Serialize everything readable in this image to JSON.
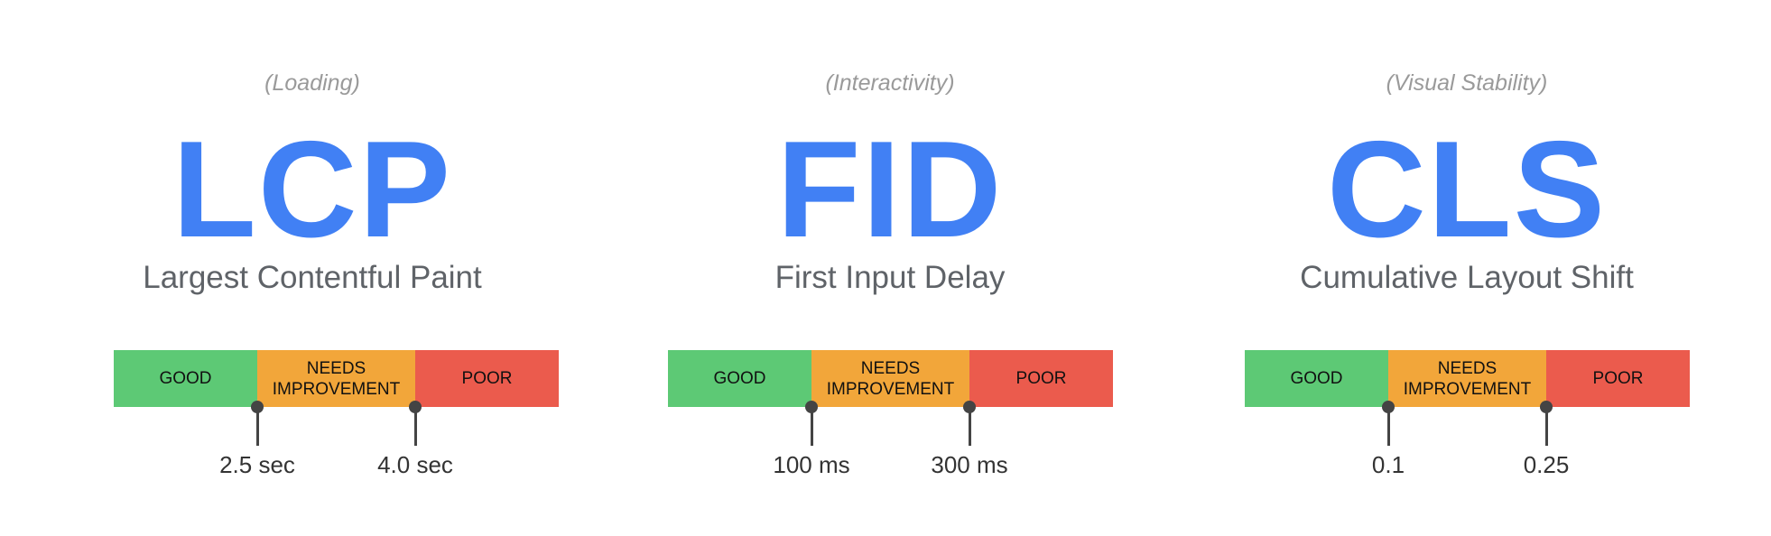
{
  "colors": {
    "accent": "#4180F4",
    "good": "#5DC975",
    "needs_improvement": "#F2A63A",
    "poor": "#EB5B4D"
  },
  "bands": {
    "good": "GOOD",
    "needs_line1": "NEEDS",
    "needs_line2": "IMPROVEMENT",
    "poor": "POOR"
  },
  "metrics": [
    {
      "category": "(Loading)",
      "abbr": "LCP",
      "name": "Largest Contentful Paint",
      "threshold1": "2.5 sec",
      "threshold2": "4.0 sec"
    },
    {
      "category": "(Interactivity)",
      "abbr": "FID",
      "name": "First Input Delay",
      "threshold1": "100 ms",
      "threshold2": "300 ms"
    },
    {
      "category": "(Visual Stability)",
      "abbr": "CLS",
      "name": "Cumulative Layout Shift",
      "threshold1": "0.1",
      "threshold2": "0.25"
    }
  ]
}
